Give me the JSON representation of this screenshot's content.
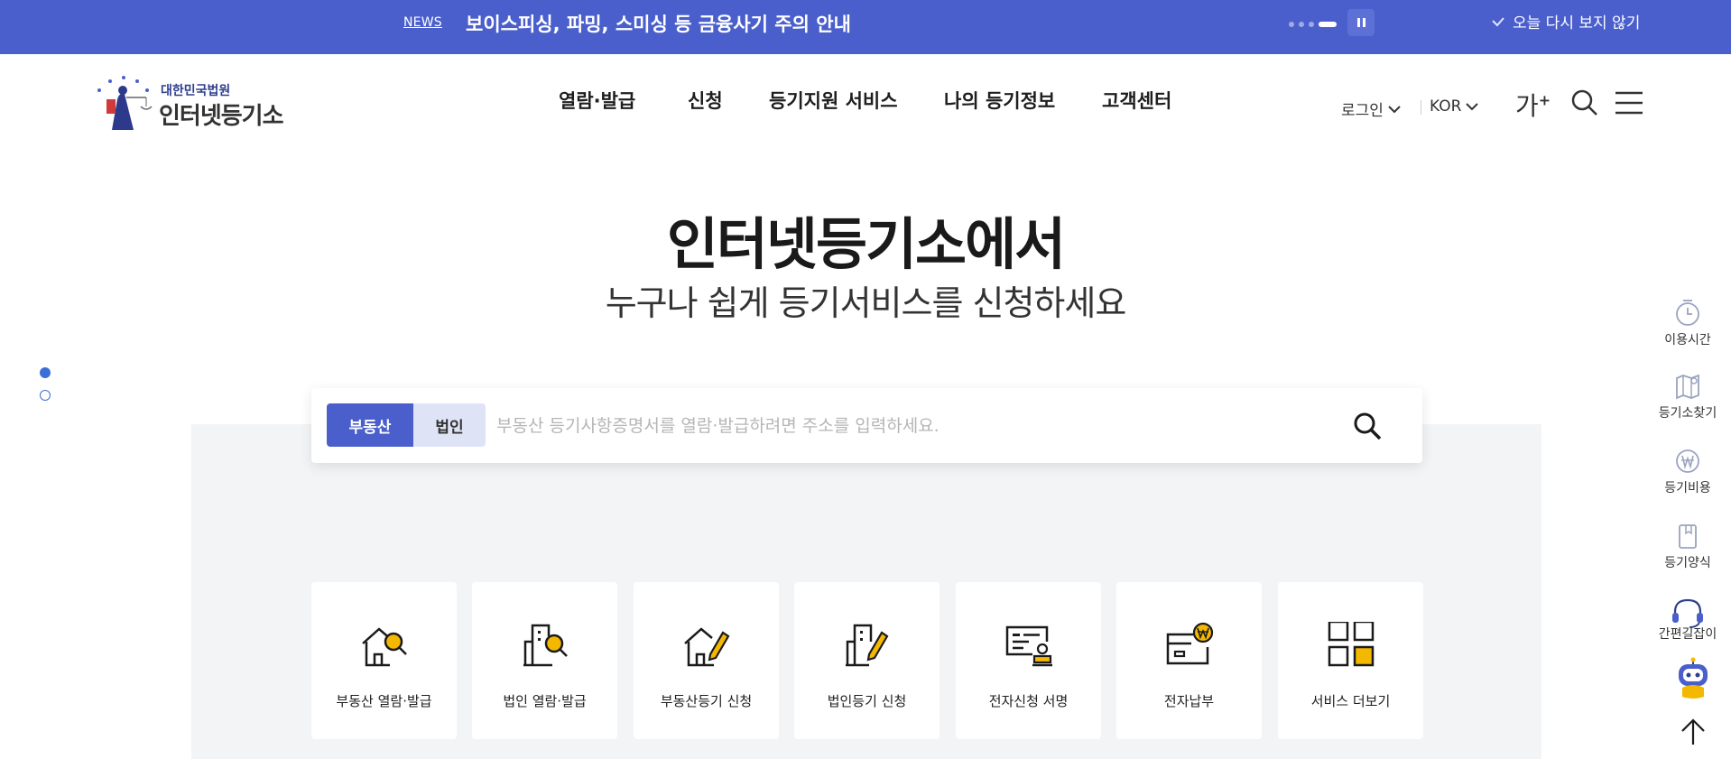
{
  "topbar": {
    "news_tag": "NEWS",
    "news_title": "보이스피싱, 파밍, 스미싱 등 금융사기 주의 안내",
    "dismiss_label": "오늘 다시 보지 않기",
    "bg_color": "#4a5fcb"
  },
  "logo": {
    "org": "대한민국법원",
    "name": "인터넷등기소"
  },
  "gnb": {
    "items": [
      "열람·발급",
      "신청",
      "등기지원 서비스",
      "나의 등기정보",
      "고객센터"
    ]
  },
  "util": {
    "login": "로그인",
    "language": "KOR",
    "font_size_label": "가",
    "font_size_mark": "+"
  },
  "hero": {
    "title": "인터넷등기소에서",
    "subtitle": "누구나 쉽게 등기서비스를 신청하세요"
  },
  "search": {
    "tabs": [
      "부동산",
      "법인"
    ],
    "active_tab": "부동산",
    "placeholder": "부동산 등기사항증명서를 열람·발급하려면 주소를 입력하세요.",
    "value": ""
  },
  "services": [
    {
      "label": "부동산 열람·발급",
      "icon": "house-search-icon"
    },
    {
      "label": "법인 열람·발급",
      "icon": "building-search-icon"
    },
    {
      "label": "부동산등기 신청",
      "icon": "house-pen-icon"
    },
    {
      "label": "법인등기 신청",
      "icon": "building-pen-icon"
    },
    {
      "label": "전자신청 서명",
      "icon": "document-stamp-icon"
    },
    {
      "label": "전자납부",
      "icon": "wallet-won-icon"
    },
    {
      "label": "서비스 더보기",
      "icon": "grid-more-icon"
    }
  ],
  "quick_menu": [
    {
      "label": "이용시간",
      "icon": "clock-icon"
    },
    {
      "label": "등기소찾기",
      "icon": "map-icon"
    },
    {
      "label": "등기비용",
      "icon": "won-coin-icon"
    },
    {
      "label": "등기양식",
      "icon": "book-icon"
    },
    {
      "label": "간편길잡이",
      "icon": "headset-icon"
    }
  ],
  "colors": {
    "accent": "#4a5fcb",
    "accent_light": "#dfe3f6",
    "icon_highlight": "#f5b800",
    "band_bg": "#f3f4f6"
  }
}
